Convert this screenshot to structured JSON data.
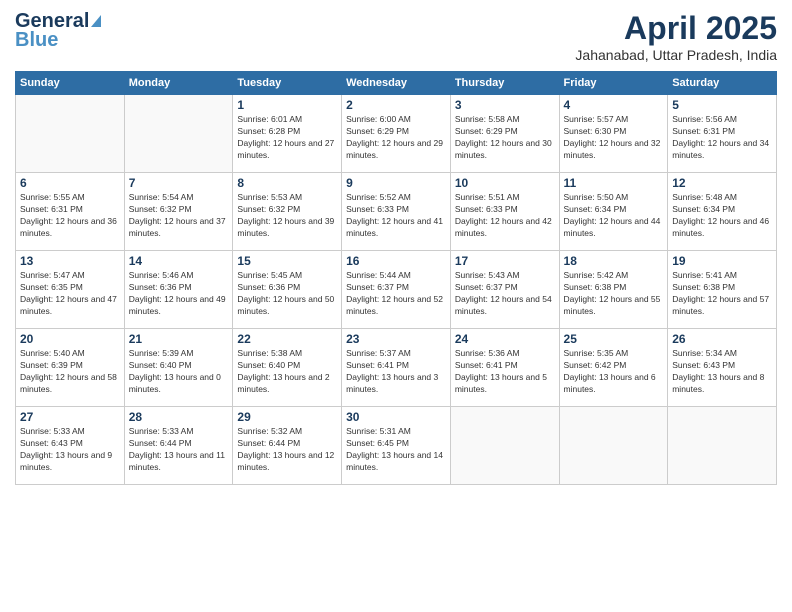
{
  "header": {
    "logo_general": "General",
    "logo_blue": "Blue",
    "month_title": "April 2025",
    "location": "Jahanabad, Uttar Pradesh, India"
  },
  "days_of_week": [
    "Sunday",
    "Monday",
    "Tuesday",
    "Wednesday",
    "Thursday",
    "Friday",
    "Saturday"
  ],
  "weeks": [
    [
      {
        "day": "",
        "info": ""
      },
      {
        "day": "",
        "info": ""
      },
      {
        "day": "1",
        "info": "Sunrise: 6:01 AM\nSunset: 6:28 PM\nDaylight: 12 hours and 27 minutes."
      },
      {
        "day": "2",
        "info": "Sunrise: 6:00 AM\nSunset: 6:29 PM\nDaylight: 12 hours and 29 minutes."
      },
      {
        "day": "3",
        "info": "Sunrise: 5:58 AM\nSunset: 6:29 PM\nDaylight: 12 hours and 30 minutes."
      },
      {
        "day": "4",
        "info": "Sunrise: 5:57 AM\nSunset: 6:30 PM\nDaylight: 12 hours and 32 minutes."
      },
      {
        "day": "5",
        "info": "Sunrise: 5:56 AM\nSunset: 6:31 PM\nDaylight: 12 hours and 34 minutes."
      }
    ],
    [
      {
        "day": "6",
        "info": "Sunrise: 5:55 AM\nSunset: 6:31 PM\nDaylight: 12 hours and 36 minutes."
      },
      {
        "day": "7",
        "info": "Sunrise: 5:54 AM\nSunset: 6:32 PM\nDaylight: 12 hours and 37 minutes."
      },
      {
        "day": "8",
        "info": "Sunrise: 5:53 AM\nSunset: 6:32 PM\nDaylight: 12 hours and 39 minutes."
      },
      {
        "day": "9",
        "info": "Sunrise: 5:52 AM\nSunset: 6:33 PM\nDaylight: 12 hours and 41 minutes."
      },
      {
        "day": "10",
        "info": "Sunrise: 5:51 AM\nSunset: 6:33 PM\nDaylight: 12 hours and 42 minutes."
      },
      {
        "day": "11",
        "info": "Sunrise: 5:50 AM\nSunset: 6:34 PM\nDaylight: 12 hours and 44 minutes."
      },
      {
        "day": "12",
        "info": "Sunrise: 5:48 AM\nSunset: 6:34 PM\nDaylight: 12 hours and 46 minutes."
      }
    ],
    [
      {
        "day": "13",
        "info": "Sunrise: 5:47 AM\nSunset: 6:35 PM\nDaylight: 12 hours and 47 minutes."
      },
      {
        "day": "14",
        "info": "Sunrise: 5:46 AM\nSunset: 6:36 PM\nDaylight: 12 hours and 49 minutes."
      },
      {
        "day": "15",
        "info": "Sunrise: 5:45 AM\nSunset: 6:36 PM\nDaylight: 12 hours and 50 minutes."
      },
      {
        "day": "16",
        "info": "Sunrise: 5:44 AM\nSunset: 6:37 PM\nDaylight: 12 hours and 52 minutes."
      },
      {
        "day": "17",
        "info": "Sunrise: 5:43 AM\nSunset: 6:37 PM\nDaylight: 12 hours and 54 minutes."
      },
      {
        "day": "18",
        "info": "Sunrise: 5:42 AM\nSunset: 6:38 PM\nDaylight: 12 hours and 55 minutes."
      },
      {
        "day": "19",
        "info": "Sunrise: 5:41 AM\nSunset: 6:38 PM\nDaylight: 12 hours and 57 minutes."
      }
    ],
    [
      {
        "day": "20",
        "info": "Sunrise: 5:40 AM\nSunset: 6:39 PM\nDaylight: 12 hours and 58 minutes."
      },
      {
        "day": "21",
        "info": "Sunrise: 5:39 AM\nSunset: 6:40 PM\nDaylight: 13 hours and 0 minutes."
      },
      {
        "day": "22",
        "info": "Sunrise: 5:38 AM\nSunset: 6:40 PM\nDaylight: 13 hours and 2 minutes."
      },
      {
        "day": "23",
        "info": "Sunrise: 5:37 AM\nSunset: 6:41 PM\nDaylight: 13 hours and 3 minutes."
      },
      {
        "day": "24",
        "info": "Sunrise: 5:36 AM\nSunset: 6:41 PM\nDaylight: 13 hours and 5 minutes."
      },
      {
        "day": "25",
        "info": "Sunrise: 5:35 AM\nSunset: 6:42 PM\nDaylight: 13 hours and 6 minutes."
      },
      {
        "day": "26",
        "info": "Sunrise: 5:34 AM\nSunset: 6:43 PM\nDaylight: 13 hours and 8 minutes."
      }
    ],
    [
      {
        "day": "27",
        "info": "Sunrise: 5:33 AM\nSunset: 6:43 PM\nDaylight: 13 hours and 9 minutes."
      },
      {
        "day": "28",
        "info": "Sunrise: 5:33 AM\nSunset: 6:44 PM\nDaylight: 13 hours and 11 minutes."
      },
      {
        "day": "29",
        "info": "Sunrise: 5:32 AM\nSunset: 6:44 PM\nDaylight: 13 hours and 12 minutes."
      },
      {
        "day": "30",
        "info": "Sunrise: 5:31 AM\nSunset: 6:45 PM\nDaylight: 13 hours and 14 minutes."
      },
      {
        "day": "",
        "info": ""
      },
      {
        "day": "",
        "info": ""
      },
      {
        "day": "",
        "info": ""
      }
    ]
  ]
}
